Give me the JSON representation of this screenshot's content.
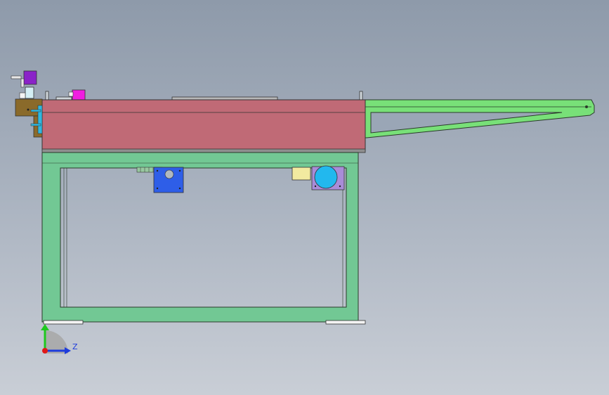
{
  "triad": {
    "axis_z_label": "Z",
    "colors": {
      "y_axis": "#1ec81e",
      "z_axis": "#1e3cdc",
      "x_axis": "#e01818"
    }
  },
  "colors": {
    "table_top": "#c06a76",
    "frame": "#72c894",
    "arm": "#78e078",
    "motor_left": "#2e5ee8",
    "motor_right": "#22b8ee",
    "motor_right_plate": "#a98cd8",
    "block_yellow": "#f2eaa0",
    "purple_part": "#8a22c8",
    "magenta_part": "#f01ee0",
    "bracket_brown": "#8a6a2a",
    "clip_cyan": "#30b8e0"
  }
}
